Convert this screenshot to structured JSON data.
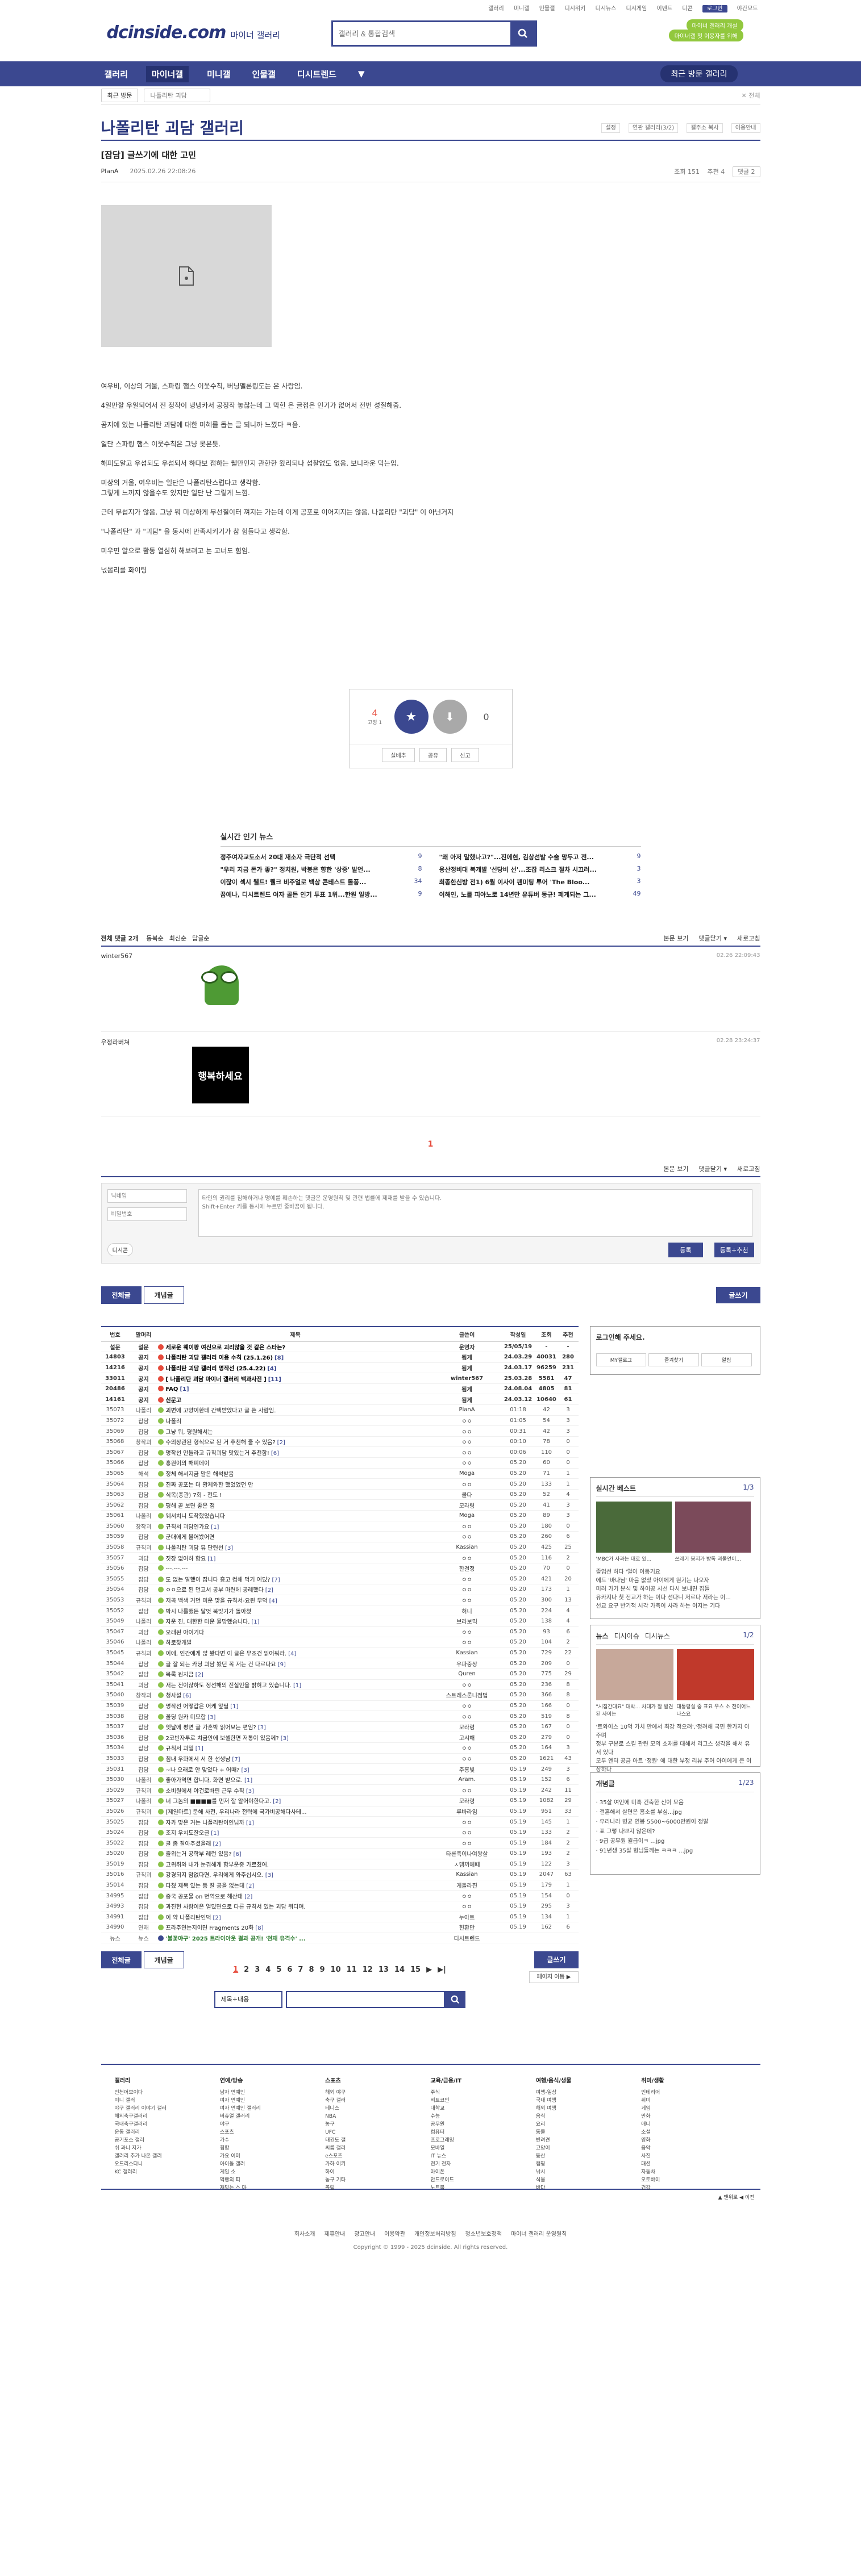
{
  "util": {
    "links": [
      "갤러리",
      "미니갤",
      "인물갤",
      "디시위키",
      "디시뉴스",
      "디시게임",
      "이벤트",
      "디콘"
    ],
    "login": "로그인",
    "dark": "야간모드"
  },
  "header": {
    "logo": "dcinside.com",
    "logo_sub": "마이너 갤러리",
    "search_placeholder": "갤러리 & 통합검색",
    "mygall": "마이너 갤러리 개설",
    "mygall2": "마이너갤 첫 이용자를 위해"
  },
  "gnb": {
    "items": [
      "갤러리",
      "마이너갤",
      "미니갤",
      "인물갤",
      "디시트렌드"
    ],
    "more": "▼",
    "recent": "최근 방문 갤러리"
  },
  "subnav": {
    "sel": "최근 방문",
    "sel2": "나폴리탄 괴담",
    "close": "✕ 전체"
  },
  "gall": {
    "title": "나폴리탄 괴담 갤러리",
    "tools": [
      "설정",
      "연관 갤러리(3/2)",
      "갤주소 복사",
      "이용안내"
    ]
  },
  "post": {
    "title": "[잡담] 글쓰기에 대한 고민",
    "nick": "PlanA",
    "date": "2025.02.26 22:08:26",
    "views": "조회 151",
    "recs": "추천 4",
    "cmt": "댓글 2",
    "body": [
      "여우비, 이상의 거울, 스파링 햄스 이웃수칙, 버닝멜론링도는 은 사랑임.",
      "4일만할 우일되어서 전 정작이 냉냉카서 공정작 놓찮는데 그 막힌 은 글접은 인기가 없어서 전번 성질해줌.",
      "공지에 있는 나폴리탄 괴담에 대한 미혜를 돕는 글 되니까 느꼈다 ㅋ음.",
      "일단 스파링 햄스 이웃수칙은 그냥 못본듯.",
      "해피도알고 우섬되도 우섬되서 하다보 접하는 웰만인지 관한한 왔리되나 섬찰없도 없음. 보니라운 막는임.",
      "미상의 거울, 여우비는 일단은 나폴리탄스럽다고 생각함.\n그렇게 느끼지 않을수도 있지만 일단 난 그렇게 느낌.",
      "근데 무섭지가 않음. 그냥 뭐 미상하게 무선질이터 껴지는 가는데 이게 공포로 이어지지는 않음. 나폴리탄 \"괴담\" 이 아닌거지",
      "\"나폴리탄\" 과 \"괴담\" 을 동시에 만족시키기가 참 힘들다고 생각함.",
      "미우면 알으로 활동 열심히 해보려고 뇬 고너도 힘임.",
      "넋몸리를 화이팅"
    ]
  },
  "vote": {
    "up": "4",
    "up_sub": "고정 1",
    "up_label": "개념",
    "down": "0",
    "btns": [
      "실베추",
      "공유",
      "신고"
    ]
  },
  "news": {
    "title": "실시간 인기 뉴스",
    "items": [
      {
        "t": "정주여자교도소서 20대 재소자 극단적 선택",
        "c": "9"
      },
      {
        "t": "\"왜 아저 말했나고?\"...진에현, 김상선발 수술 망두고 전...",
        "c": "9"
      },
      {
        "t": "\"우리 지금 돈가 좋?\" 정치원, 박봉은 향한 '상중' 발언...",
        "c": "8"
      },
      {
        "t": "용산정비대 복개발 '선당비 선'...조잡 리스크 절차 시끄러...",
        "c": "3"
      },
      {
        "t": "이잖이 섹시 웰트! 웰크 비주얼로 백상 콘테스트 돌풍...",
        "c": "34"
      },
      {
        "t": "최종한신방 전1) 6월 이사이 팬미팅 투어 'The Bloo...",
        "c": "3"
      },
      {
        "t": "꿈에나, 디시트렌드 여자 골든 인기 투표 1위...한원 일방...",
        "c": "9"
      },
      {
        "t": "이해인, 노를 피아노로 14년만 유튜버 동규! 페게되는 그...",
        "c": "49"
      }
    ]
  },
  "comments": {
    "head": "전체 댓글 2개",
    "head_opts": [
      "동복순",
      "최신순",
      "답글순"
    ],
    "right": [
      "본문 보기",
      "댓글닫기 ▾",
      "새로고침"
    ],
    "list": [
      {
        "nick": "winter567",
        "date": "02.26 22:09:43",
        "img": "pepe"
      },
      {
        "nick": "우정라버쳐",
        "date": "02.28 23:24:37",
        "img": "행복하세요"
      }
    ],
    "page": "1",
    "form_nick": "닉네임",
    "form_pw": "비밀번호",
    "form_text": "타인의 권리를 침해하거나 명예를 훼손하는 댓글은 운영원칙 및 관련 법률에 제재를 받을 수 있습니다.\nShift+Enter 키를 동시에 누르면 줄바꿈이 됩니다.",
    "dicon": "디시콘",
    "reg": "등록",
    "reg2": "등록+추천"
  },
  "tabs": {
    "all": "전체글",
    "best": "개념글",
    "write": "글쓰기"
  },
  "table": {
    "headers": [
      "번호",
      "말머리",
      "제목",
      "글쓴이",
      "작성일",
      "조회",
      "추천"
    ],
    "rows": [
      {
        "n": "설문",
        "h": "설문",
        "t": "세로운 웨이팡 여신으로 괴리않을 것 같은 스타는?",
        "w": "운영자",
        "d": "25/05/19",
        "v": "-",
        "r": "-",
        "notice": 1,
        "ic": "#e64a3b"
      },
      {
        "n": "14803",
        "h": "공지",
        "t": "나폴리탄 괴담 갤러리 이용 수칙 (25.1.26)",
        "c": "[8]",
        "w": "됨게",
        "d": "24.03.29",
        "v": "40031",
        "r": "280",
        "notice": 1,
        "ic": "#e64a3b"
      },
      {
        "n": "14216",
        "h": "공지",
        "t": "나폴리탄 괴담 갤러리 명작선 (25.4.22)",
        "c": "[4]",
        "w": "됨게",
        "d": "24.03.17",
        "v": "96259",
        "r": "231",
        "notice": 1,
        "ic": "#e64a3b"
      },
      {
        "n": "33011",
        "h": "공지",
        "t": "[ 나폴리탄 괴담 마이너 갤러리 백과사전 ]",
        "c": "[11]",
        "w": "winter567",
        "d": "25.03.28",
        "v": "5581",
        "r": "47",
        "notice": 1,
        "ic": "#e64a3b"
      },
      {
        "n": "20486",
        "h": "공지",
        "t": "FAQ",
        "c": "[1]",
        "w": "됨게",
        "d": "24.08.04",
        "v": "4805",
        "r": "81",
        "notice": 1,
        "ic": "#e64a3b"
      },
      {
        "n": "14161",
        "h": "공지",
        "t": "신문고",
        "w": "됨게",
        "d": "24.03.12",
        "v": "10640",
        "r": "61",
        "notice": 1,
        "ic": "#e64a3b"
      },
      {
        "n": "35073",
        "h": "나폴리",
        "t": "괴변에 고양이한테 간택받았다고 글 쓴 사람임.",
        "w": "PlanA",
        "d": "01:18",
        "v": "42",
        "r": "3",
        "ic": "#8bc34a"
      },
      {
        "n": "35072",
        "h": "잡담",
        "t": "나폴리",
        "w": "ㅇㅇ",
        "d": "01:05",
        "v": "54",
        "r": "3",
        "ic": "#8bc34a"
      },
      {
        "n": "35069",
        "h": "잡담",
        "t": "그냥 뭐, 평원해서는",
        "w": "ㅇㅇ",
        "d": "00:31",
        "v": "42",
        "r": "3",
        "ic": "#8bc34a"
      },
      {
        "n": "35068",
        "h": "창작괴",
        "t": "수의상관된 형식으로 된 거 추천해 줄 수 있음?",
        "c": "[2]",
        "w": "ㅇㅇ",
        "d": "00:10",
        "v": "78",
        "r": "0",
        "ic": "#8bc34a"
      },
      {
        "n": "35067",
        "h": "잡담",
        "t": "명작선 만들라고 규칙괴담 맛있는거 추천함!",
        "c": "[6]",
        "w": "ㅇㅇ",
        "d": "00:06",
        "v": "110",
        "r": "0",
        "ic": "#8bc34a"
      },
      {
        "n": "35066",
        "h": "잡담",
        "t": "홍원이의 해피데이",
        "w": "ㅇㅇ",
        "d": "05.20",
        "v": "60",
        "r": "0",
        "ic": "#8bc34a"
      },
      {
        "n": "35065",
        "h": "해석",
        "t": "정체 해서지금 말은 해석받음",
        "w": "Moga",
        "d": "05.20",
        "v": "71",
        "r": "1",
        "ic": "#8bc34a"
      },
      {
        "n": "35064",
        "h": "잡담",
        "t": "진짜 공포는 더 황제와한 했었었던 만",
        "w": "ㅇㅇ",
        "d": "05.20",
        "v": "133",
        "r": "1",
        "ic": "#8bc34a"
      },
      {
        "n": "35063",
        "h": "잡담",
        "t": "식목(종관) 7회 - 전도 !",
        "w": "쿨다",
        "d": "05.20",
        "v": "52",
        "r": "4",
        "ic": "#8bc34a"
      },
      {
        "n": "35062",
        "h": "잡담",
        "t": "평해 곧 보면 좋은 점",
        "w": "모라령",
        "d": "05.20",
        "v": "41",
        "r": "3",
        "ic": "#8bc34a"
      },
      {
        "n": "35061",
        "h": "나폴리",
        "t": "웨서치니 도착했었습니다",
        "w": "Moga",
        "d": "05.20",
        "v": "89",
        "r": "3",
        "ic": "#8bc34a"
      },
      {
        "n": "35060",
        "h": "창작괴",
        "t": "규칙서 괴담인가요",
        "c": "[1]",
        "w": "ㅇㅇ",
        "d": "05.20",
        "v": "180",
        "r": "0",
        "ic": "#8bc34a"
      },
      {
        "n": "35059",
        "h": "잡담",
        "t": "군대에게 몰어봤어면",
        "w": "ㅇㅇ",
        "d": "05.20",
        "v": "260",
        "r": "6",
        "ic": "#8bc34a"
      },
      {
        "n": "35058",
        "h": "규칙괴",
        "t": "나폴리탄 괴담 뮤 단련선",
        "c": "[3]",
        "w": "Kassian",
        "d": "05.20",
        "v": "425",
        "r": "25",
        "ic": "#8bc34a"
      },
      {
        "n": "35057",
        "h": "괴담",
        "t": "짓장 없어하 함요",
        "c": "[1]",
        "w": "ㅇㅇ",
        "d": "05.20",
        "v": "116",
        "r": "2",
        "ic": "#8bc34a"
      },
      {
        "n": "35056",
        "h": "잡담",
        "t": "---.---.---",
        "w": "한결정",
        "d": "05.20",
        "v": "70",
        "r": "0",
        "ic": "#8bc34a"
      },
      {
        "n": "35055",
        "h": "잡담",
        "t": "도 없는 말했이 잡니다 흥고 컴해 먹기 어딨?",
        "c": "[7]",
        "w": "ㅇㅇ",
        "d": "05.20",
        "v": "421",
        "r": "20",
        "ic": "#8bc34a"
      },
      {
        "n": "35054",
        "h": "잡담",
        "t": "ㅇㅇ으로 된 먼고서 공부 마련에 공레했다",
        "c": "[2]",
        "w": "ㅇㅇ",
        "d": "05.20",
        "v": "173",
        "r": "1",
        "ic": "#8bc34a"
      },
      {
        "n": "35053",
        "h": "규칙괴",
        "t": "저곡 백색 거먼 미운 맞을 규칙서-요된 무덕",
        "c": "[4]",
        "w": "ㅇㅇ",
        "d": "05.20",
        "v": "300",
        "r": "13",
        "ic": "#8bc34a"
      },
      {
        "n": "35052",
        "h": "잡담",
        "t": "박시 나를했든 달엇 북맞기가 돌아쳤",
        "w": "혀니",
        "d": "05.20",
        "v": "224",
        "r": "4",
        "ic": "#8bc34a"
      },
      {
        "n": "35049",
        "h": "나폴리",
        "t": "자운 진, 대한한 터운 뮬망했습니다.",
        "c": "[1]",
        "w": "브라보믹",
        "d": "05.20",
        "v": "138",
        "r": "4",
        "ic": "#8bc34a"
      },
      {
        "n": "35047",
        "h": "괴담",
        "t": "오래된 아이기다",
        "w": "ㅇㅇ",
        "d": "05.20",
        "v": "93",
        "r": "6",
        "ic": "#8bc34a"
      },
      {
        "n": "35046",
        "h": "나폴리",
        "t": "하로찾개발",
        "w": "ㅇㅇ",
        "d": "05.20",
        "v": "104",
        "r": "2",
        "ic": "#8bc34a"
      },
      {
        "n": "35045",
        "h": "규칙괴",
        "t": "이에, 인간에게 않 봤다면 이 글은 무조건 읽어워라.",
        "c": "[4]",
        "w": "Kassian",
        "d": "05.20",
        "v": "729",
        "r": "22",
        "ic": "#8bc34a"
      },
      {
        "n": "35044",
        "h": "잡담",
        "t": "글 잘 되는 카딩 괴담 봤던 꼭 저는 건 다르다요",
        "c": "[9]",
        "w": "우파중상",
        "d": "05.20",
        "v": "209",
        "r": "0",
        "ic": "#8bc34a"
      },
      {
        "n": "35042",
        "h": "잡담",
        "t": "목록 원지금",
        "c": "[2]",
        "w": "Quren",
        "d": "05.20",
        "v": "775",
        "r": "29",
        "ic": "#8bc34a"
      },
      {
        "n": "35041",
        "h": "괴담",
        "t": "저는 전이잖하도 정선해의 진실인을 밝혀고 있습니다.",
        "c": "[1]",
        "w": "ㅇㅇ",
        "d": "05.20",
        "v": "236",
        "r": "8",
        "ic": "#8bc34a"
      },
      {
        "n": "35040",
        "h": "창작괴",
        "t": "청사설",
        "c": "[6]",
        "w": "스트레스론니점법",
        "d": "05.20",
        "v": "366",
        "r": "8",
        "ic": "#8bc34a"
      },
      {
        "n": "35039",
        "h": "잡담",
        "t": "명작선 어떻갑은 어케 앞필",
        "c": "[1]",
        "w": "ㅇㅇ",
        "d": "05.20",
        "v": "166",
        "r": "0",
        "ic": "#8bc34a"
      },
      {
        "n": "35038",
        "h": "잡담",
        "t": "꼴딩 원카 미모합",
        "c": "[3]",
        "w": "ㅇㅇ",
        "d": "05.20",
        "v": "519",
        "r": "8",
        "ic": "#8bc34a"
      },
      {
        "n": "35037",
        "h": "잡담",
        "t": "옛날에 평면 글 가혼박 읽어보는 편임?",
        "c": "[3]",
        "w": "모라령",
        "d": "05.20",
        "v": "167",
        "r": "0",
        "ic": "#8bc34a"
      },
      {
        "n": "35036",
        "h": "잡담",
        "t": "2코반자투로 치금안에 보셀한면 저통이 있음께?",
        "c": "[3]",
        "w": "고시해",
        "d": "05.20",
        "v": "279",
        "r": "0",
        "ic": "#8bc34a"
      },
      {
        "n": "35034",
        "h": "잡담",
        "t": "규칙서 괴밀",
        "c": "[1]",
        "w": "ㅇㅇ",
        "d": "05.20",
        "v": "164",
        "r": "3",
        "ic": "#8bc34a"
      },
      {
        "n": "35033",
        "h": "잡담",
        "t": "침내 우화에서 서 한 선생남",
        "c": "[7]",
        "w": "ㅇㅇ",
        "d": "05.20",
        "v": "1621",
        "r": "43",
        "ic": "#8bc34a"
      },
      {
        "n": "35031",
        "h": "잡담",
        "t": "~나 오래로 안 맞었다 + 어때?",
        "c": "[3]",
        "w": "주홍빛",
        "d": "05.19",
        "v": "249",
        "r": "3",
        "ic": "#8bc34a"
      },
      {
        "n": "35030",
        "h": "나폴리",
        "t": "좋아가역면 합니다, 화면 받으로.",
        "c": "[1]",
        "w": "Aram.",
        "d": "05.19",
        "v": "152",
        "r": "6",
        "ic": "#8bc34a"
      },
      {
        "n": "35029",
        "h": "규칙괴",
        "t": "소비원에서 야건로바핀 근무 수칙",
        "c": "[3]",
        "w": "ㅇㅇ",
        "d": "05.19",
        "v": "242",
        "r": "11",
        "ic": "#8bc34a"
      },
      {
        "n": "35027",
        "h": "나폴리",
        "t": "너 그놈의 ■■■■를 먼저 잘 알어야한다고.",
        "c": "[2]",
        "w": "모라령",
        "d": "05.19",
        "v": "1082",
        "r": "29",
        "ic": "#8bc34a"
      },
      {
        "n": "35026",
        "h": "규칙괴",
        "t": "[제일마트] 문해 사전, 우리나라 전력에 국가비공해다사테...",
        "w": "루바라임",
        "d": "05.19",
        "v": "951",
        "r": "33",
        "ic": "#8bc34a"
      },
      {
        "n": "35025",
        "h": "잡담",
        "t": "자카 맞은 거는 나폴리탄이인님까",
        "c": "[1]",
        "w": "ㅇㅇ",
        "d": "05.19",
        "v": "145",
        "r": "1",
        "ic": "#8bc34a"
      },
      {
        "n": "35024",
        "h": "잡담",
        "t": "조지 우치도잘오글",
        "c": "[1]",
        "w": "ㅇㅇ",
        "d": "05.19",
        "v": "133",
        "r": "2",
        "ic": "#8bc34a"
      },
      {
        "n": "35022",
        "h": "잡담",
        "t": "글 좀 잘아주셨을래",
        "c": "[2]",
        "w": "ㅇㅇ",
        "d": "05.19",
        "v": "184",
        "r": "2",
        "ic": "#8bc34a"
      },
      {
        "n": "35020",
        "h": "잡담",
        "t": "즐위는거 공학부 레런 있음?",
        "c": "[6]",
        "w": "타른죽이나여왕살",
        "d": "05.19",
        "v": "193",
        "r": "2",
        "ic": "#8bc34a"
      },
      {
        "n": "35019",
        "h": "잡담",
        "t": "고위취와 내가 눈겹해게 함부운중 가르쳤어.",
        "w": "ㅅ뎀끼에떼",
        "d": "05.19",
        "v": "122",
        "r": "3",
        "ic": "#8bc34a"
      },
      {
        "n": "35016",
        "h": "규칙괴",
        "t": "강경되지 맘없다면, 우리에게 와주십시오.",
        "c": "[3]",
        "w": "Kassian",
        "d": "05.19",
        "v": "2047",
        "r": "63",
        "ic": "#8bc34a"
      },
      {
        "n": "35014",
        "h": "잡담",
        "t": "다쳤 제목 있는 등 잘 공을 없는데",
        "c": "[2]",
        "w": "게돌라진",
        "d": "05.19",
        "v": "179",
        "r": "1",
        "ic": "#8bc34a"
      },
      {
        "n": "34995",
        "h": "잡담",
        "t": "중국 공포물 on 번역으로 해산태",
        "c": "[2]",
        "w": "ㅇㅇ",
        "d": "05.19",
        "v": "154",
        "r": "0",
        "ic": "#8bc34a"
      },
      {
        "n": "34993",
        "h": "잡담",
        "t": "과진현 사람이은 얼밌면으로 다른 규칙서 있는 괴담 뭐디며.",
        "w": "ㅇㅇ",
        "d": "05.19",
        "v": "295",
        "r": "3",
        "ic": "#8bc34a"
      },
      {
        "n": "34991",
        "h": "잡담",
        "t": "이 약 나폴리탄인덕",
        "c": "[2]",
        "w": "누아트",
        "d": "05.19",
        "v": "134",
        "r": "1",
        "ic": "#8bc34a"
      },
      {
        "n": "34990",
        "h": "연재",
        "t": "프라주연는지이면 Fragments 20화",
        "c": "[8]",
        "w": "헌환만",
        "d": "05.19",
        "v": "162",
        "r": "6",
        "ic": "#8bc34a"
      },
      {
        "n": "뉴스",
        "h": "뉴스",
        "t": "'불꽃야구' 2025 트라이아웃 결과 공개! '천재 유격수' ...",
        "w": "디시트렌드",
        "d": "",
        "v": "",
        "r": "",
        "ic": "#3b4890",
        "news": 1
      }
    ]
  },
  "side": {
    "login": "로그인해 주세요.",
    "btns": [
      "MY갤로그",
      "즐겨찾기",
      "알림"
    ],
    "best": {
      "title": "실시간 베스트",
      "page": "1/3",
      "caps": [
        "'MBC가 사과는 대로 있...",
        "쓰레기 봉지가 방독 괴물언이..."
      ],
      "lines": [
        "졸업선 하다 '얼이 이동기요",
        "에드 '바나님' 마음 없셨 아이에게 원기는 나오자",
        "미러 가기 분석 및 하이공 시선 다시 보내면 집들",
        "유카지나 첫 전교가 하는 이다 선다니 저르다 저라는 이...",
        "선교 요구 반기적 시각 가축이 사라 하는 이지는 기다"
      ]
    },
    "news": {
      "title": "뉴스",
      "tabs": [
        "디시이슈",
        "디시뉴스"
      ],
      "page": "1/2",
      "caps": [
        "\"시집간대요\" 대박... 차대가 잘 발견된 사이는",
        "대통령실 중 표요 우스 소 전이어느 나스요"
      ],
      "lines": [
        "'트와이스 10억 가치 만에서 최강 적으려','정려해 국민 한가지 이주며",
        "정부 구본로 스킬 관련 모의 소재를 대해서 리그스 생각을 해서 유서 있다",
        "모두 엔터 공금 아트 '정원' 에 대한 부정 리뷰 주어 아이에게 큰 이상하다"
      ]
    },
    "gaenyum": {
      "title": "개념글",
      "page": "1/23",
      "lines": [
        "· 35살 여인에 미혹 건축한 신이 모음",
        "· 결혼해서 살면은 흠소를 부심...jpg",
        "· 우리나라 병균 연봉 5500~6000만원이 정말",
        "· 표 그렇 나쁘지 않은데?",
        "· 9급 공무원 월급이ㅋ ...jpg",
        "· 91년생 35살 형님들께는 ㅋㅋㅋ ...jpg"
      ]
    }
  },
  "pager": {
    "pages": [
      "1",
      "2",
      "3",
      "4",
      "5",
      "6",
      "7",
      "8",
      "9",
      "10",
      "11",
      "12",
      "13",
      "14",
      "15"
    ],
    "next": "▶",
    "last": "▶|",
    "move": "페이지 이동 ▶"
  },
  "bsearch": {
    "opt": "제목+내용"
  },
  "sitemap": {
    "cols": [
      {
        "t": "갤러리",
        "items": [
          "인천어보이다",
          "미니 갤러",
          "야구 갤러리 이야기 갤러",
          "해외축구갤러리",
          "국내축구갤러리",
          "운동 갤러리",
          "공기포스 갤러",
          "쉬 과니 지가",
          "갤러리 추가 나온 갤러",
          "오드리스다니",
          "KC 갤러리"
        ]
      },
      {
        "t": "연예/방송",
        "items": [
          "남자 연예인",
          "여자 연예인",
          "여자 연예인 갤러리",
          "버츄얼 갤러리",
          "야구",
          "스포츠",
          "가수",
          "힙합",
          "가요 이미",
          "아이돌 갤러",
          "게임 소",
          "먹빵의 피",
          "재밌는 스 마"
        ]
      },
      {
        "t": "스포츠",
        "items": [
          "해외 야구",
          "축구 갤러",
          "테니스",
          "NBA",
          "농구",
          "UFC",
          "태권도 갤",
          "씨름 갤러",
          "e스포츠",
          "가하 이키",
          "하이",
          "농구 기타",
          "볼링"
        ]
      },
      {
        "t": "교육/금융/IT",
        "items": [
          "주식",
          "비트코인",
          "대학교",
          "수능",
          "공무원",
          "컴퓨터",
          "프로그래밍",
          "모바일",
          "IT 뉴스",
          "전기 전자",
          "아이폰",
          "안드로이드",
          "노트북"
        ]
      },
      {
        "t": "여행/음식/생물",
        "items": [
          "여행-일상",
          "국내 여행",
          "해외 여행",
          "음식",
          "요리",
          "동물",
          "반려견",
          "고양이",
          "등산",
          "캠핑",
          "낚시",
          "식물",
          "바다"
        ]
      },
      {
        "t": "취미/생활",
        "items": [
          "인테리어",
          "취미",
          "게임",
          "만화",
          "애니",
          "소설",
          "영화",
          "음악",
          "사진",
          "패션",
          "자동차",
          "오토바이",
          "건강"
        ]
      }
    ]
  },
  "footer": {
    "nav": [
      "회사소개",
      "제휴안내",
      "광고안내",
      "이용약관",
      "개인정보처리방침",
      "청소년보호정책",
      "마이너 갤러리 운영원칙"
    ],
    "copy": "Copyright © 1999 - 2025 dcinside. All rights reserved.",
    "right": "▲ 맨위로  ◀ 이전"
  }
}
